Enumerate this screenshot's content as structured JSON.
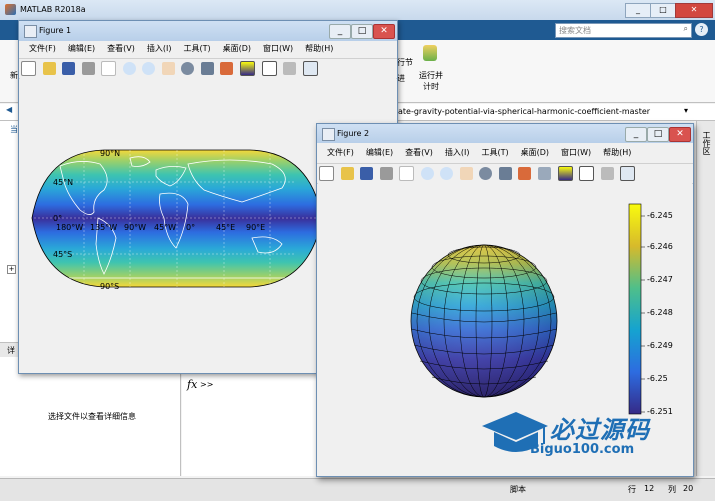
{
  "main_window": {
    "title": "MATLAB R2018a",
    "search_placeholder": "搜索文档",
    "path": "ate-gravity-potential-via-spherical-harmonic-coefficient-master",
    "toolbar_run_section": "行节",
    "toolbar_advance": "进",
    "toolbar_run_time": "运行并",
    "toolbar_run_time2": "计时",
    "new_label": "新",
    "current_label": "当",
    "detail_label": "详",
    "workspace_label": "工作区",
    "detail_text": "选择文件以查看详细信息",
    "fx_symbol": "fx",
    "prompt": ">>",
    "status_script": "脚本",
    "status_row_label": "行",
    "status_row": "12",
    "status_col_label": "列",
    "status_col": "20"
  },
  "figure1": {
    "title": "Figure 1",
    "menu": [
      "文件(F)",
      "编辑(E)",
      "查看(V)",
      "插入(I)",
      "工具(T)",
      "桌面(D)",
      "窗口(W)",
      "帮助(H)"
    ],
    "lat_labels": [
      "90°N",
      "45°N",
      "0°",
      "45°S",
      "90°S"
    ],
    "lon_labels": [
      "180°W",
      "135°W",
      "90°W",
      "45°W",
      "0°",
      "45°E",
      "90°E"
    ]
  },
  "figure2": {
    "title": "Figure 2",
    "menu": [
      "文件(F)",
      "编辑(E)",
      "查看(V)",
      "插入(I)",
      "工具(T)",
      "桌面(D)",
      "窗口(W)",
      "帮助(H)"
    ],
    "colorbar_ticks": [
      "-6.245",
      "-6.246",
      "-6.247",
      "-6.248",
      "-6.249",
      "-6.25",
      "-6.251"
    ]
  },
  "watermark": {
    "text": "必过源码",
    "url": "Biguo100.com"
  },
  "colors": {
    "accent": "#1f6fb5",
    "parula_dark": "#352a87",
    "parula_yellow": "#f9fb0e"
  }
}
